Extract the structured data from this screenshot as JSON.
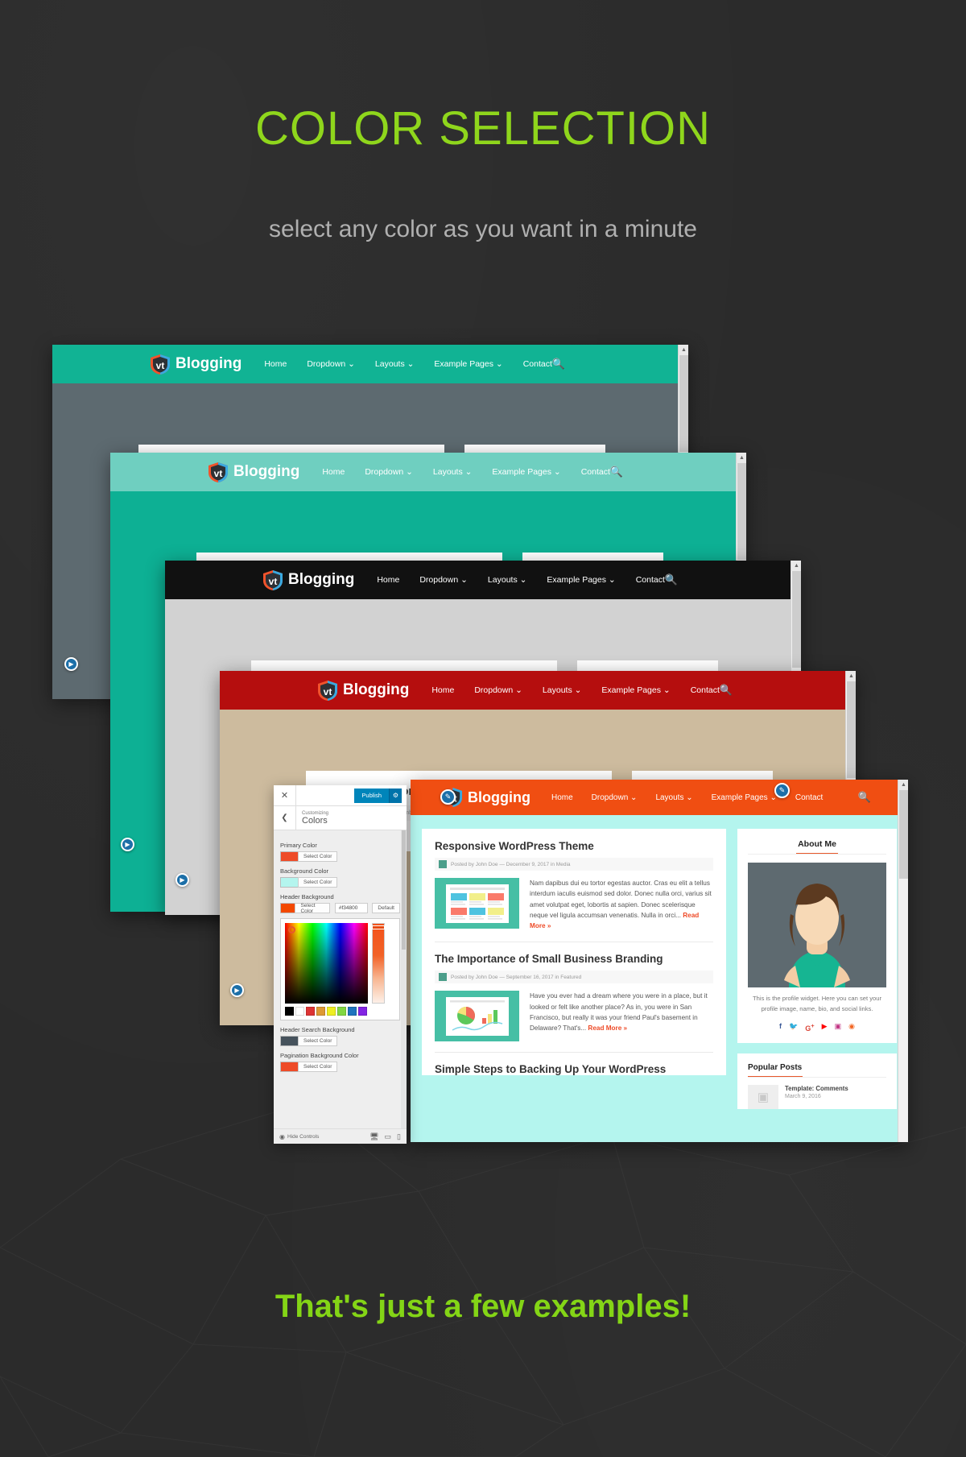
{
  "hero": {
    "title": "COLOR SELECTION",
    "subtitle": "select any color as you want in a minute",
    "footnote": "That's just a few examples!",
    "title_color": "#8fd61c",
    "subtitle_color": "#b0b0b0",
    "background_color": "#2b2b2b"
  },
  "site": {
    "brand": "Blogging",
    "brand_mark": "vt",
    "menu": [
      "Home",
      "Dropdown",
      "Layouts",
      "Example Pages",
      "Contact"
    ],
    "menu_caret": "⌄",
    "search_icon": "search-icon"
  },
  "windows": [
    {
      "id": "window-1",
      "header_color": "#11b394",
      "body_color": "#5d6a70",
      "label": "teal"
    },
    {
      "id": "window-2",
      "header_color": "#6fcfc0",
      "body_color": "#0db094",
      "label": "light-teal"
    },
    {
      "id": "window-3",
      "header_color": "#111111",
      "body_color": "#d2d2d2",
      "label": "black"
    },
    {
      "id": "window-4",
      "header_color": "#b50e0e",
      "body_color": "#cdbb9e",
      "label": "red"
    },
    {
      "id": "window-5",
      "header_color": "#f04e12",
      "body_color": "#b4f5ee",
      "label": "orange"
    }
  ],
  "posts": [
    {
      "title": "Responsive WordPress Theme",
      "meta": "Posted by John Doe — December 9, 2017 in Media",
      "excerpt": "Nam dapibus dui eu tortor egestas auctor. Cras eu elit a tellus interdum iaculis euismod sed dolor. Donec nulla orci, varius sit amet volutpat eget, lobortis at sapien. Donec scelerisque neque vel ligula accumsan venenatis. Nulla in orci...",
      "read_more": "Read More »",
      "thumb": "layout-grid-thumbnail"
    },
    {
      "title": "The Importance of Small Business Branding",
      "meta": "Posted by John Doe — September 16, 2017 in Featured",
      "excerpt": "Have you ever had a dream where you were in a place, but it looked or felt like another place? As in, you were in San Francisco, but really it was your friend Paul's basement in Delaware? That's...",
      "read_more": "Read More »",
      "thumb": "chart-thumbnail"
    },
    {
      "title": "Simple Steps to Backing Up Your WordPress",
      "meta": "",
      "excerpt": "",
      "read_more": "",
      "thumb": ""
    }
  ],
  "sidebar": {
    "about": {
      "heading": "About Me",
      "bio": "This is the profile widget. Here you can set your profile image, name, bio, and social links.",
      "socials": [
        "facebook-icon",
        "twitter-icon",
        "google-plus-icon",
        "youtube-icon",
        "instagram-icon",
        "rss-icon"
      ]
    },
    "popular": {
      "heading": "Popular Posts",
      "items": [
        {
          "title": "Template: Comments",
          "date": "March 9, 2016"
        }
      ]
    }
  },
  "customizer": {
    "close_label": "✕",
    "publish_label": "Publish",
    "gear_icon": "gear-icon",
    "back_icon": "chevron-left-icon",
    "breadcrumb": "Customizing",
    "panel_title": "Colors",
    "select_color_label": "Select Color",
    "default_label": "Default",
    "header_hex_value": "#f34800",
    "controls": [
      {
        "label": "Primary Color",
        "swatch": "#ee4b28",
        "has_input": false,
        "has_default": false
      },
      {
        "label": "Background Color",
        "swatch": "#b4f5ee",
        "has_input": false,
        "has_default": false
      },
      {
        "label": "Header Background",
        "swatch": "#f34800",
        "has_input": true,
        "has_default": true
      },
      {
        "label": "Header Search Background",
        "swatch": "#46525c",
        "has_input": false,
        "has_default": false
      },
      {
        "label": "Pagination Background Color",
        "swatch": "#ee4b28",
        "has_input": false,
        "has_default": false
      }
    ],
    "picker_swatches": [
      "#000000",
      "#ffffff",
      "#dd3333",
      "#dd9933",
      "#eeee22",
      "#81d742",
      "#1e73be",
      "#8224e3"
    ],
    "hide_controls_label": "Hide Controls",
    "device_icons": [
      "desktop-icon",
      "tablet-icon",
      "mobile-icon"
    ]
  }
}
